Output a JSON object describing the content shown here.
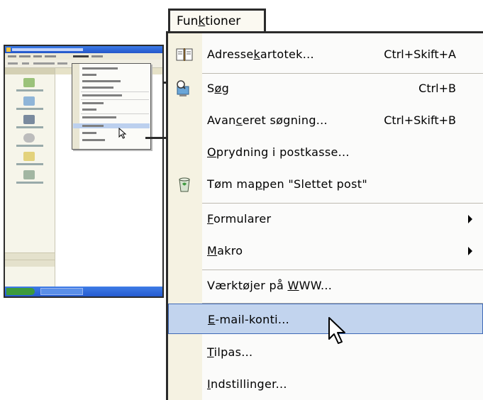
{
  "menu": {
    "title": {
      "pre": "Fun",
      "u": "k",
      "post": "tioner"
    },
    "items": [
      {
        "pre": "Adresse",
        "u": "k",
        "post": "artotek...",
        "shortcut": "Ctrl+Skift+A",
        "icon": "address-book-icon"
      },
      {
        "pre": "S",
        "u": "ø",
        "post": "g",
        "shortcut": "Ctrl+B",
        "icon": "search-computer-icon"
      },
      {
        "pre": "Avan",
        "u": "c",
        "post": "eret søgning...",
        "shortcut": "Ctrl+Skift+B"
      },
      {
        "pre": "",
        "u": "O",
        "post": "prydning i postkasse..."
      },
      {
        "pre": "Tøm ma",
        "u": "p",
        "post": "pen \"Slettet post\"",
        "icon": "recycle-bin-icon"
      },
      {
        "pre": "",
        "u": "F",
        "post": "ormularer",
        "submenu": true
      },
      {
        "pre": "",
        "u": "M",
        "post": "akro",
        "submenu": true
      },
      {
        "pre": "Værktøjer på ",
        "u": "W",
        "post": "WW..."
      },
      {
        "pre": "",
        "u": "E",
        "post": "-mail-konti...",
        "highlighted": true
      },
      {
        "pre": "",
        "u": "T",
        "post": "ilpas..."
      },
      {
        "pre": "",
        "u": "I",
        "post": "ndstillinger..."
      }
    ]
  },
  "colors": {
    "highlight": "#c2d4ee",
    "highlight_border": "#3f69b6",
    "gutter": "#f5f2e2",
    "frame": "#2b2b2b"
  }
}
